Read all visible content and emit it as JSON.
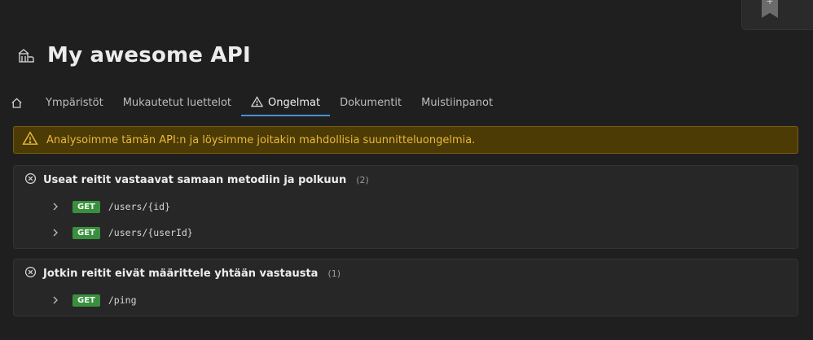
{
  "corner": {
    "plus_label": "+",
    "icon": "bookmark-icon"
  },
  "header": {
    "title": "My awesome API",
    "icon": "api-building-icon"
  },
  "tabs": [
    {
      "label": "Ympäristöt",
      "active": false
    },
    {
      "label": "Mukautetut luettelot",
      "active": false
    },
    {
      "label": "Ongelmat",
      "active": true,
      "icon": "warning-icon"
    },
    {
      "label": "Dokumentit",
      "active": false
    },
    {
      "label": "Muistiinpanot",
      "active": false
    }
  ],
  "banner": {
    "text": "Analysoimme tämän API:n ja löysimme joitakin mahdollisia suunnitteluongelmia.",
    "icon": "warning-icon"
  },
  "issues": [
    {
      "title": "Useat reitit vastaavat samaan metodiin ja polkuun",
      "count": "(2)",
      "icon": "circle-x-icon",
      "routes": [
        {
          "method": "GET",
          "path": "/users/{id}"
        },
        {
          "method": "GET",
          "path": "/users/{userId}"
        }
      ]
    },
    {
      "title": "Jotkin reitit eivät määrittele yhtään vastausta",
      "count": "(1)",
      "icon": "circle-x-icon",
      "routes": [
        {
          "method": "GET",
          "path": "/ping"
        }
      ]
    }
  ],
  "colors": {
    "accent": "#4a8fd6",
    "warning_bg": "#4d3b06",
    "warning_text": "#e8b93a",
    "get_badge": "#3a8f3f"
  }
}
